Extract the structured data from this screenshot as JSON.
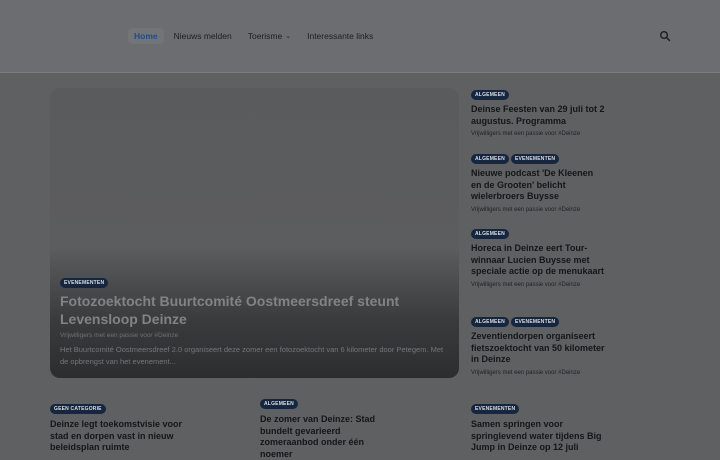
{
  "nav": {
    "items": [
      {
        "label": "Home",
        "active": true
      },
      {
        "label": "Nieuws melden"
      },
      {
        "label": "Toerisme",
        "has_dropdown": true
      },
      {
        "label": "Interessante links"
      }
    ],
    "search_icon": "search-icon"
  },
  "hero": {
    "category": "EVENEMENTEN",
    "title": "Fotozoektocht Buurtcomité Oostmeersdreef steunt Levensloop Deinze",
    "meta": "Vrijwilligers met een passie voor #Deinze",
    "excerpt": "Het Buurtcomité Oostmeersdreef 2.0 organiseert deze zomer een fotozoektocht van 6 kilometer door Petegem. Met de opbrengst van het evenement..."
  },
  "sidebar": [
    {
      "categories": [
        "ALGEMEEN"
      ],
      "title": "Deinse Feesten van 29 juli tot 2 augustus. Programma",
      "meta": "Vrijwilligers met een passie voor #Deinze"
    },
    {
      "categories": [
        "ALGEMEEN",
        "EVENEMENTEN"
      ],
      "title": "Nieuwe podcast 'De Kleenen en de Grooten' belicht wielerbroers Buysse",
      "meta": "Vrijwilligers met een passie voor #Deinze"
    },
    {
      "categories": [
        "ALGEMEEN"
      ],
      "title": "Horeca in Deinze eert Tour-winnaar Lucien Buysse met speciale actie op de menukaart",
      "meta": "Vrijwilligers met een passie voor #Deinze"
    },
    {
      "categories": [
        "ALGEMEEN",
        "EVENEMENTEN"
      ],
      "title": "Zeventiendorpen organiseert fietszoektocht van 50 kilometer in Deinze",
      "meta": "Vrijwilligers met een passie voor #Deinze"
    }
  ],
  "bottom": [
    {
      "category": "GEEN CATEGORIE",
      "title": "Deinze legt toekomstvisie voor stad en dorpen vast in nieuw beleidsplan ruimte"
    },
    {
      "category": "ALGEMEEN",
      "title": "De zomer van Deinze: Stad bundelt gevarieerd zomeraanbod onder één noemer"
    },
    {
      "category": "EVENEMENTEN",
      "title": "Samen springen voor springlevend water tijdens Big Jump in Deinze op 12 juli"
    }
  ]
}
